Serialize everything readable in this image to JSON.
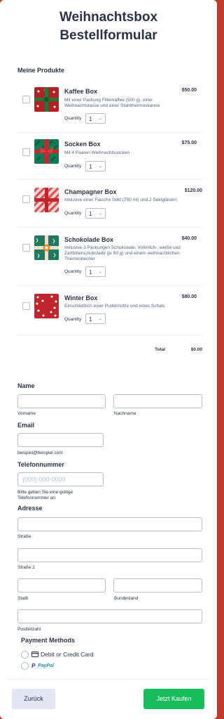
{
  "form": {
    "title_line1": "Weihnachtsbox",
    "title_line2": "Bestellformular"
  },
  "products_section": {
    "label": "Meine Produkte",
    "quantity_label": "Quantity",
    "items": [
      {
        "name": "Kaffee Box",
        "description": "Mit einer Packung Filterkaffee (500 g), einer Weihnachtstasse und einer Stahlthermoskanne",
        "price": "$50.00",
        "quantity": "1",
        "thumb_color": "#b81f24"
      },
      {
        "name": "Socken Box",
        "description": "Mit 4 Paaren Weihnachtssocken",
        "price": "$75.00",
        "quantity": "1",
        "thumb_color": "#127a55"
      },
      {
        "name": "Champagner Box",
        "description": "Inklusive einer Flasche Sekt (750 ml) und 2 Sektgläsern",
        "price": "$120.00",
        "quantity": "1",
        "thumb_color": "#d94f4f"
      },
      {
        "name": "Schokolade Box",
        "description": "Inklusive 3 Packungen Schokolade: Vollmilch-, weiße und Zartbitterschokolade (je 60 g) und einem weihnachtlichen Themenbecher",
        "price": "$40.00",
        "quantity": "1",
        "thumb_color": "#1e7a5e"
      },
      {
        "name": "Winter Box",
        "description": "Einschließlich einer Pudelmütze und eines Schals",
        "price": "$80.00",
        "quantity": "1",
        "thumb_color": "#c0272d"
      }
    ],
    "total_label": "Total",
    "total_value": "$0.00"
  },
  "name_field": {
    "label": "Name",
    "first_sub": "Vorname",
    "last_sub": "Nachname"
  },
  "email_field": {
    "label": "Email",
    "sub": "beispiel@beispiel.com"
  },
  "phone_field": {
    "label": "Telefonnummer",
    "placeholder": "(000) 000-0000",
    "sub": "Bitte geben Sie eine gültige Telefonnummer an."
  },
  "address_field": {
    "label": "Adresse",
    "street": "Straße",
    "street2": "Straße 2",
    "city": "Stadt",
    "state": "Bundesland",
    "zip": "Postleitzahl"
  },
  "payment": {
    "label": "Payment Methods",
    "card": "Debit or Credit Card",
    "paypal_p": "P",
    "paypal": "PayPal"
  },
  "footer": {
    "back": "Zurück",
    "submit": "Jetzt Kaufen"
  },
  "colors": {
    "accent_green": "#18bd5b",
    "frame_red": "#c0392b",
    "back_button": "#e3e5f5"
  }
}
